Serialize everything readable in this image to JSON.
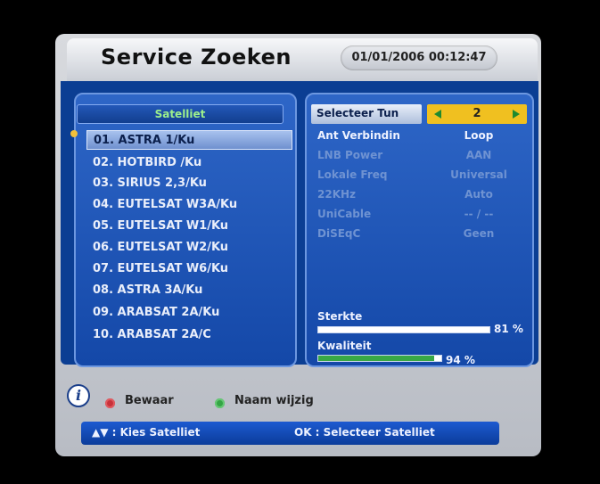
{
  "screen": {
    "title": "Service Zoeken",
    "datetime": "01/01/2006 00:12:47"
  },
  "satellite_list": {
    "header": "Satelliet",
    "selected_index": 0,
    "items": [
      "01. ASTRA 1/Ku",
      "02. HOTBIRD /Ku",
      "03. SIRIUS 2,3/Ku",
      "04. EUTELSAT W3A/Ku",
      "05. EUTELSAT W1/Ku",
      "06. EUTELSAT W2/Ku",
      "07. EUTELSAT W6/Ku",
      "08. ASTRA 3A/Ku",
      "09. ARABSAT 2A/Ku",
      "10. ARABSAT 2A/C"
    ]
  },
  "settings": {
    "tuner": {
      "label": "Selecteer Tun",
      "value": "2"
    },
    "rows": [
      {
        "label": "Ant Verbindin",
        "value": "Loop",
        "enabled": true
      },
      {
        "label": "LNB Power",
        "value": "AAN",
        "enabled": false
      },
      {
        "label": "Lokale Freq",
        "value": "Universal",
        "enabled": false
      },
      {
        "label": "22KHz",
        "value": "Auto",
        "enabled": false
      },
      {
        "label": "UniCable",
        "value": "-- / --",
        "enabled": false
      },
      {
        "label": "DiSEqC",
        "value": "Geen",
        "enabled": false
      }
    ]
  },
  "signal": {
    "strength": {
      "label": "Sterkte",
      "percent_text": "81 %",
      "value": 0.81
    },
    "quality": {
      "label": "Kwaliteit",
      "percent_text": "94 %",
      "value": 0.94
    }
  },
  "legend": {
    "red": "Bewaar",
    "green": "Naam wijzig"
  },
  "footer": {
    "left": "▲▼ : Kies Satelliet",
    "right": "OK : Selecteer Satelliet"
  },
  "colors": {
    "panel_blue": "#1448a8",
    "highlight_yellow": "#f0c020",
    "header_green": "#9df08c",
    "quality_green": "#38a845"
  }
}
